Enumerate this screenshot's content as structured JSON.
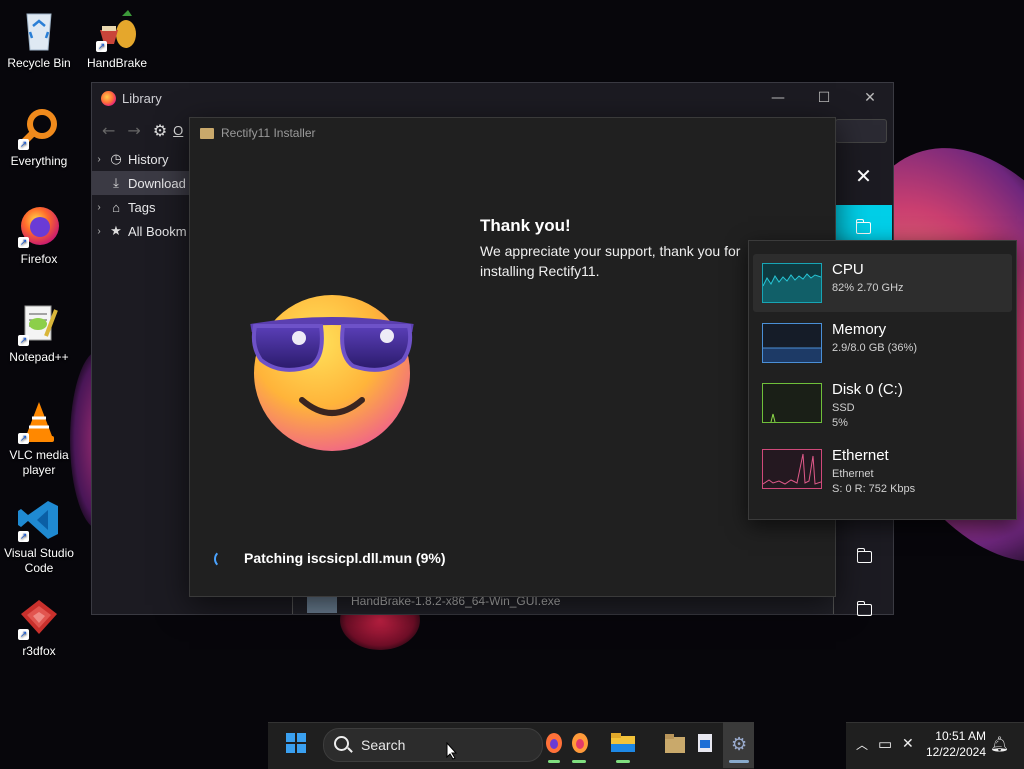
{
  "desktop": {
    "icons": [
      {
        "label": "Recycle Bin"
      },
      {
        "label": "HandBrake"
      },
      {
        "label": "Everything"
      },
      {
        "label": "Firefox"
      },
      {
        "label": "Notepad++"
      },
      {
        "label": "VLC media player"
      },
      {
        "label": "Visual Studio Code"
      },
      {
        "label": "r3dfox"
      }
    ]
  },
  "library": {
    "title": "Library",
    "toolbar_label": "O",
    "tree": [
      {
        "label": "History"
      },
      {
        "label": "Download"
      },
      {
        "label": "Tags"
      },
      {
        "label": "All Bookm"
      }
    ],
    "download_file": "HandBrake-1.8.2-x86_64-Win_GUI.exe"
  },
  "installer": {
    "title": "Rectify11 Installer",
    "heading": "Thank you!",
    "body": "We appreciate your support, thank you for installing Rectify11.",
    "status": "Patching iscsicpl.dll.mun (9%)"
  },
  "performance": {
    "items": [
      {
        "name": "CPU",
        "lines": [
          "82%  2.70 GHz"
        ],
        "color": "#17a5b5"
      },
      {
        "name": "Memory",
        "lines": [
          "2.9/8.0 GB (36%)"
        ],
        "color": "#4a8fd6"
      },
      {
        "name": "Disk 0 (C:)",
        "lines": [
          "SSD",
          "5%"
        ],
        "color": "#6fbf3a"
      },
      {
        "name": "Ethernet",
        "lines": [
          "Ethernet",
          "S: 0  R: 752 Kbps"
        ],
        "color": "#d0497a"
      }
    ]
  },
  "taskbar": {
    "search_label": "Search",
    "time": "10:51 AM",
    "date": "12/22/2024"
  }
}
